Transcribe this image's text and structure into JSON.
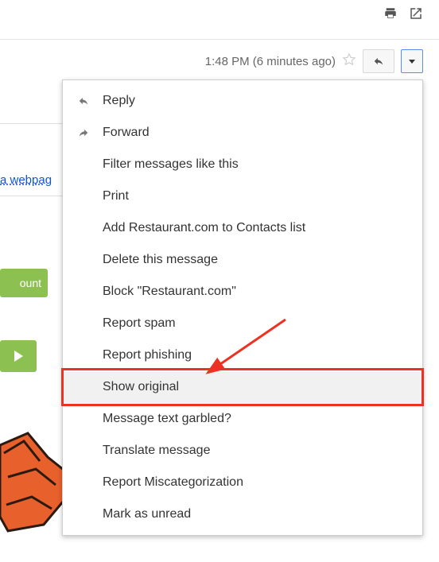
{
  "top_icons": {
    "print": "print-icon",
    "openwin": "open-new-window-icon"
  },
  "meta": {
    "time": "1:48 PM (6 minutes ago)"
  },
  "edge": {
    "link_fragment": "a webpag",
    "green1_fragment": "ount"
  },
  "menu": {
    "items": [
      {
        "label": "Reply",
        "icon": "reply",
        "highlight": false
      },
      {
        "label": "Forward",
        "icon": "forward",
        "highlight": false
      },
      {
        "label": "Filter messages like this",
        "icon": null,
        "highlight": false
      },
      {
        "label": "Print",
        "icon": null,
        "highlight": false
      },
      {
        "label": "Add Restaurant.com to Contacts list",
        "icon": null,
        "highlight": false
      },
      {
        "label": "Delete this message",
        "icon": null,
        "highlight": false
      },
      {
        "label": "Block \"Restaurant.com\"",
        "icon": null,
        "highlight": false
      },
      {
        "label": "Report spam",
        "icon": null,
        "highlight": false
      },
      {
        "label": "Report phishing",
        "icon": null,
        "highlight": false
      },
      {
        "label": "Show original",
        "icon": null,
        "highlight": true
      },
      {
        "label": "Message text garbled?",
        "icon": null,
        "highlight": false
      },
      {
        "label": "Translate message",
        "icon": null,
        "highlight": false
      },
      {
        "label": "Report Miscategorization",
        "icon": null,
        "highlight": false
      },
      {
        "label": "Mark as unread",
        "icon": null,
        "highlight": false
      }
    ]
  },
  "annotation": {
    "highlight_index": 9,
    "color": "#ec3323"
  }
}
